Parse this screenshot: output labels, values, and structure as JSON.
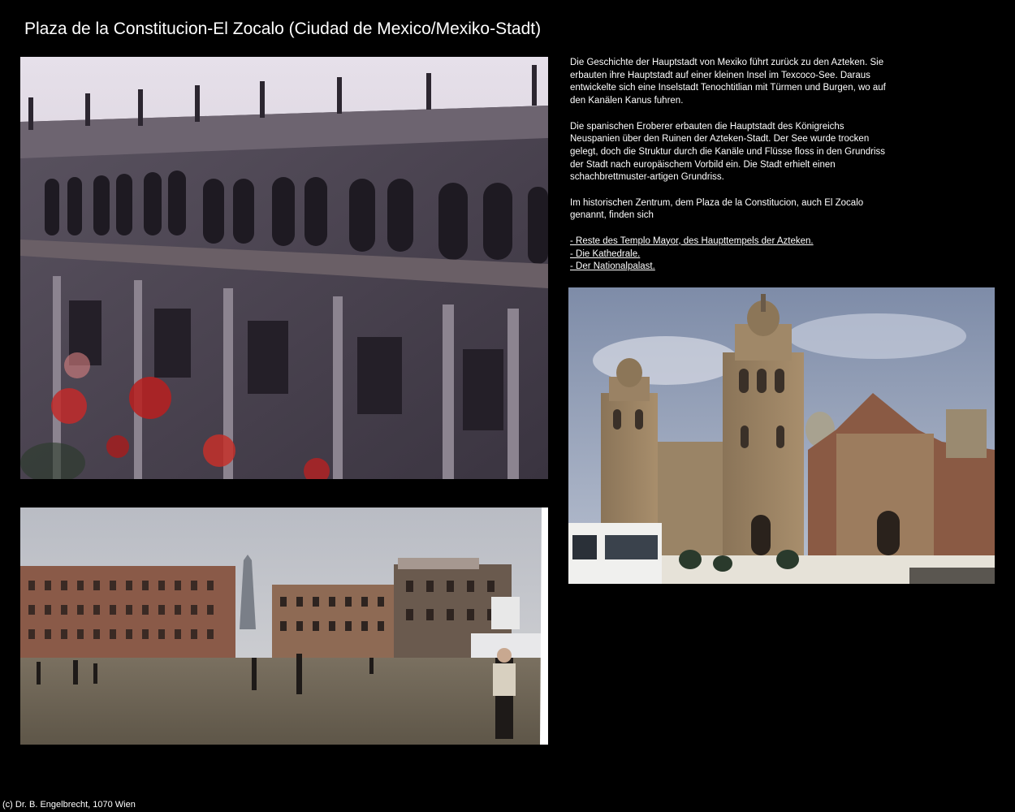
{
  "page": {
    "title": "Plaza de la Constitucion-El Zocalo (Ciudad de Mexico/Mexiko-Stadt)",
    "footer": "(c) Dr. B. Engelbrecht, 1070 Wien"
  },
  "text": {
    "paragraph_1": "Die Geschichte der Hauptstadt von Mexiko führt zurück zu den Azteken. Sie erbauten ihre Hauptstadt auf einer kleinen Insel im Texcoco-See. Daraus entwickelte sich eine Inselstadt Tenochtitlian mit Türmen und Burgen, wo auf den Kanälen Kanus fuhren.",
    "paragraph_2": "Die spanischen Eroberer erbauten die Hauptstadt des Königreichs Neuspanien über den Ruinen der Azteken-Stadt. Der See wurde trocken gelegt, doch die Struktur durch die Kanäle und Flüsse floss in den Grundriss der Stadt nach europäischem Vorbild ein. Die Stadt erhielt einen schachbrettmuster-artigen Grundriss.",
    "paragraph_3": "Im historischen Zentrum, dem Plaza de la Constitucion, auch El Zocalo genannt, finden sich"
  },
  "links": [
    {
      "label": "- Reste des Templo Mayor, des Haupttempels der Azteken."
    },
    {
      "label": "- Die Kathedrale."
    },
    {
      "label": "- Der Nationalpalast."
    }
  ],
  "photos": {
    "palace": {
      "icon": "photo-palace-facade"
    },
    "zocalo": {
      "icon": "photo-zocalo-square"
    },
    "cathedral": {
      "icon": "photo-cathedral"
    }
  },
  "colors": {
    "background": "#000000",
    "text": "#ffffff"
  }
}
